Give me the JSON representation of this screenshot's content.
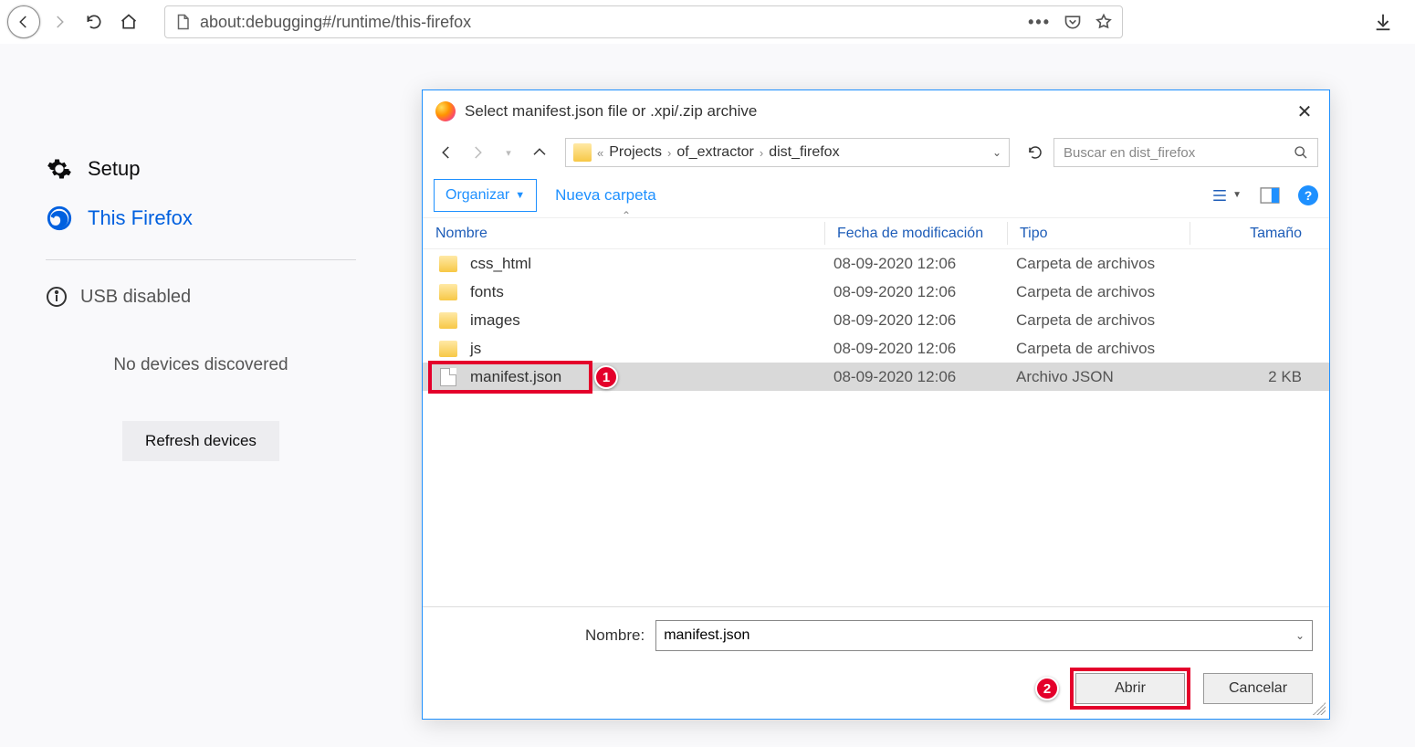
{
  "browser": {
    "url": "about:debugging#/runtime/this-firefox"
  },
  "sidebar": {
    "setup": "Setup",
    "this_firefox": "This Firefox",
    "usb_disabled": "USB disabled",
    "no_devices": "No devices discovered",
    "refresh": "Refresh devices"
  },
  "dialog": {
    "title": "Select manifest.json file or .xpi/.zip archive",
    "crumbs": {
      "c1": "Projects",
      "c2": "of_extractor",
      "c3": "dist_firefox"
    },
    "search_placeholder": "Buscar en dist_firefox",
    "organize": "Organizar",
    "new_folder": "Nueva carpeta",
    "cols": {
      "name": "Nombre",
      "date": "Fecha de modificación",
      "type": "Tipo",
      "size": "Tamaño"
    },
    "rows": [
      {
        "name": "css_html",
        "date": "08-09-2020 12:06",
        "type": "Carpeta de archivos",
        "size": "",
        "kind": "folder",
        "selected": false
      },
      {
        "name": "fonts",
        "date": "08-09-2020 12:06",
        "type": "Carpeta de archivos",
        "size": "",
        "kind": "folder",
        "selected": false
      },
      {
        "name": "images",
        "date": "08-09-2020 12:06",
        "type": "Carpeta de archivos",
        "size": "",
        "kind": "folder",
        "selected": false
      },
      {
        "name": "js",
        "date": "08-09-2020 12:06",
        "type": "Carpeta de archivos",
        "size": "",
        "kind": "folder",
        "selected": false
      },
      {
        "name": "manifest.json",
        "date": "08-09-2020 12:06",
        "type": "Archivo JSON",
        "size": "2 KB",
        "kind": "file",
        "selected": true
      }
    ],
    "name_label": "Nombre:",
    "name_value": "manifest.json",
    "open": "Abrir",
    "cancel": "Cancelar",
    "callouts": {
      "one": "1",
      "two": "2"
    }
  }
}
